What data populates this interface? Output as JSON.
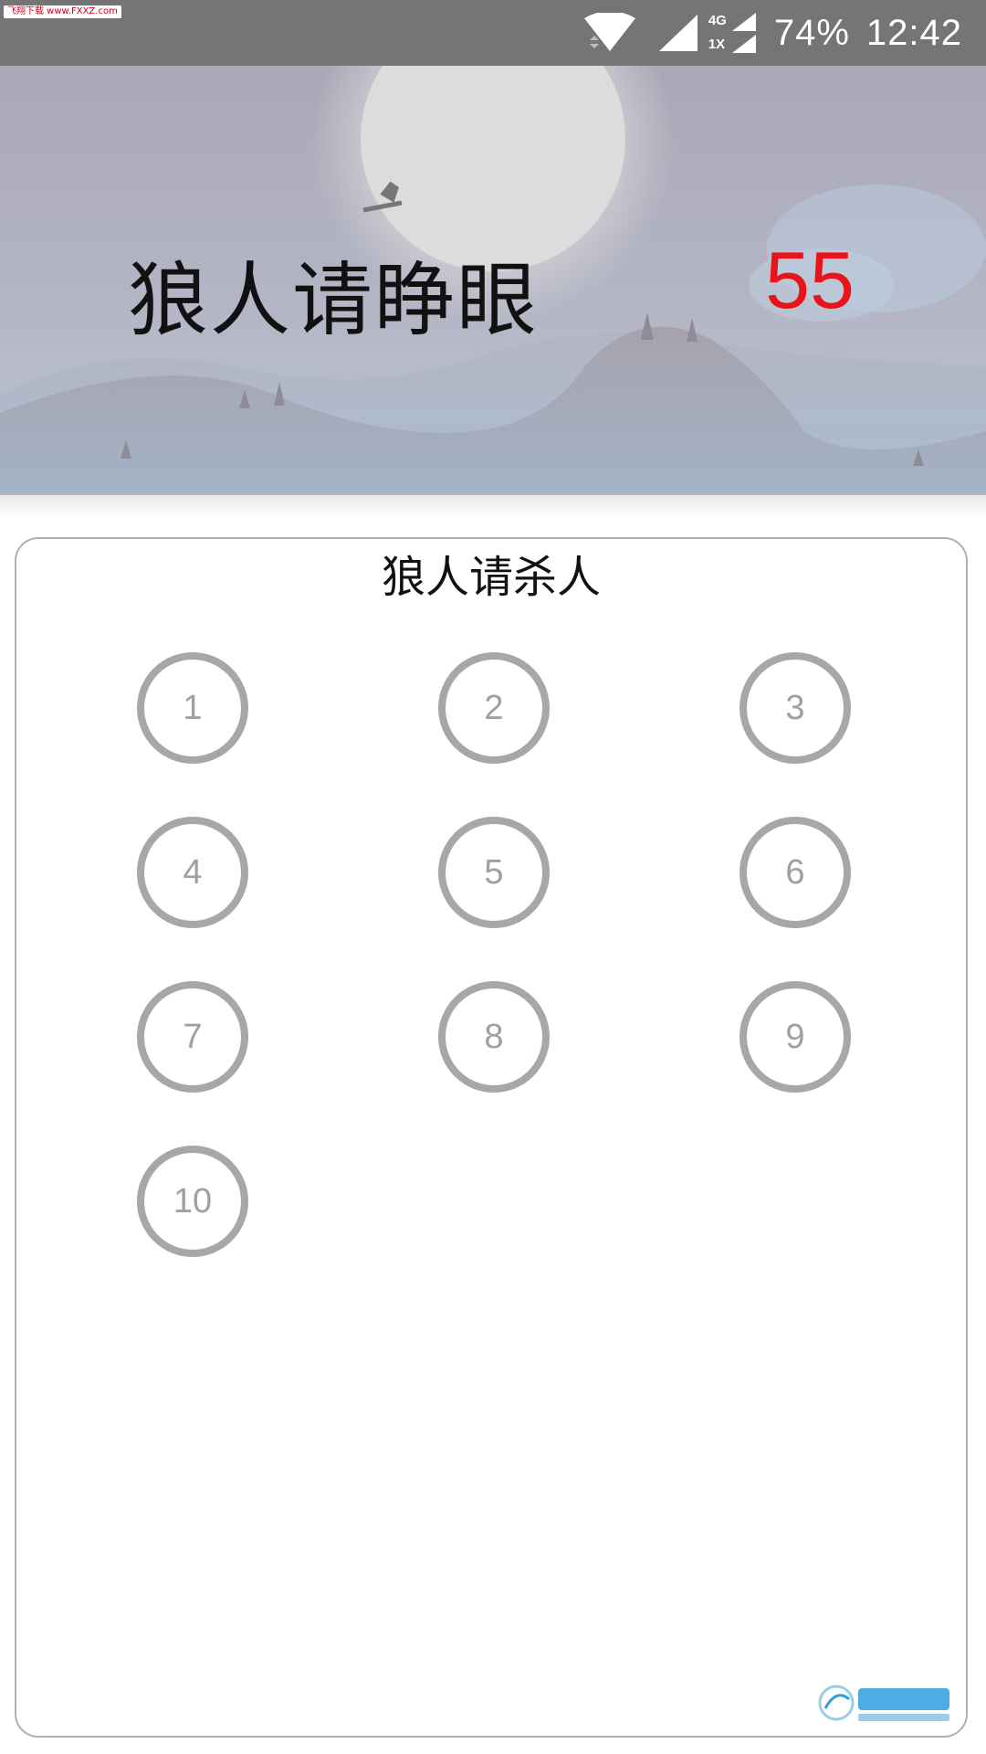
{
  "status_bar": {
    "watermark": "飞翔下载 www.FXXZ.com",
    "network_top": "4G",
    "network_bottom": "1X",
    "battery": "74%",
    "time": "12:42",
    "icons": [
      "wifi-icon",
      "cell-signal-icon",
      "cell-signal-secondary-icon"
    ]
  },
  "header": {
    "phase_title": "狼人请睁眼",
    "countdown": "55",
    "countdown_color": "#e8141c"
  },
  "panel": {
    "title": "狼人请杀人",
    "seats": [
      "1",
      "2",
      "3",
      "4",
      "5",
      "6",
      "7",
      "8",
      "9",
      "10"
    ]
  },
  "watermark_logo": {
    "brand": "飞翔下载",
    "url": "WWW.FXXZ.COM",
    "color": "#2f9de0"
  }
}
